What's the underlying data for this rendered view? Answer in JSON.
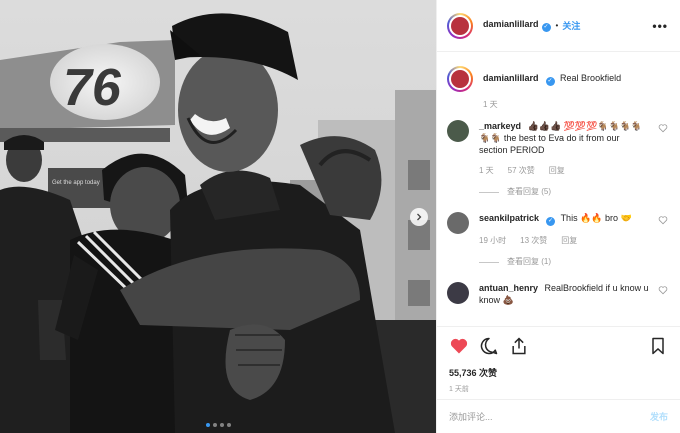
{
  "photo": {
    "sign_number": "76",
    "sign_small_text": "Get the app today",
    "carousel_count": 4,
    "carousel_active_index": 0,
    "next_icon": "chevron-right-icon"
  },
  "header": {
    "username": "damianlillard",
    "verified": true,
    "follow_separator": "•",
    "follow_label": "关注",
    "more_icon": "more-horizontal-icon"
  },
  "caption": {
    "username": "damianlillard",
    "text": "Real Brookfield",
    "time": "1 天"
  },
  "comments": [
    {
      "username": "_markeyd",
      "text": "👍🏿👍🏿👍🏿 💯💯💯🐐🐐🐐🐐🐐🐐 the best to Eva do it from our section PERIOD",
      "time": "1 天",
      "likes": "57 次赞",
      "reply": "回复",
      "view_replies": "查看回复 (5)"
    },
    {
      "username": "seankilpatrick",
      "verified": true,
      "text": "This 🔥🔥 bro 🤝",
      "time": "19 小时",
      "likes": "13 次赞",
      "reply": "回复",
      "view_replies": "查看回复 (1)"
    },
    {
      "username": "antuan_henry",
      "text": "RealBrookfield if u know u know 💩"
    }
  ],
  "actions": {
    "like_icon": "heart-filled-icon",
    "comment_icon": "comment-icon",
    "share_icon": "share-icon",
    "save_icon": "bookmark-icon"
  },
  "likes": "55,736 次赞",
  "posted_ago": "1 天前",
  "add_comment": {
    "placeholder": "添加评论...",
    "post_label": "发布"
  },
  "colors": {
    "accent": "#3897f0",
    "like": "#ed4956",
    "muted": "#999999",
    "post_disabled": "#b2dffc"
  }
}
